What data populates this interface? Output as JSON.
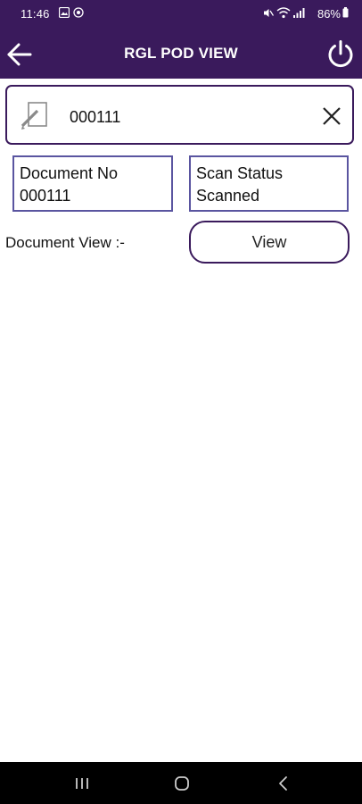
{
  "status_bar": {
    "time": "11:46",
    "battery": "86%",
    "icons": [
      "gallery-icon",
      "sync-icon",
      "mute-icon",
      "wifi-icon",
      "signal-icon",
      "battery-icon"
    ]
  },
  "header": {
    "title": "RGL POD VIEW",
    "back_icon": "arrow-left-icon",
    "power_icon": "power-icon",
    "background": "#3a1a5c"
  },
  "search": {
    "value": "000111",
    "icon": "document-edit-icon",
    "clear_icon": "close-icon"
  },
  "info": {
    "document_no_label": "Document No",
    "document_no_value": "000111",
    "scan_status_label": "Scan Status",
    "scan_status_value": "Scanned"
  },
  "document_view": {
    "label": "Document View :-",
    "button_label": "View"
  },
  "nav_bar": {
    "icons": [
      "recent-apps-icon",
      "home-icon",
      "back-icon"
    ]
  }
}
